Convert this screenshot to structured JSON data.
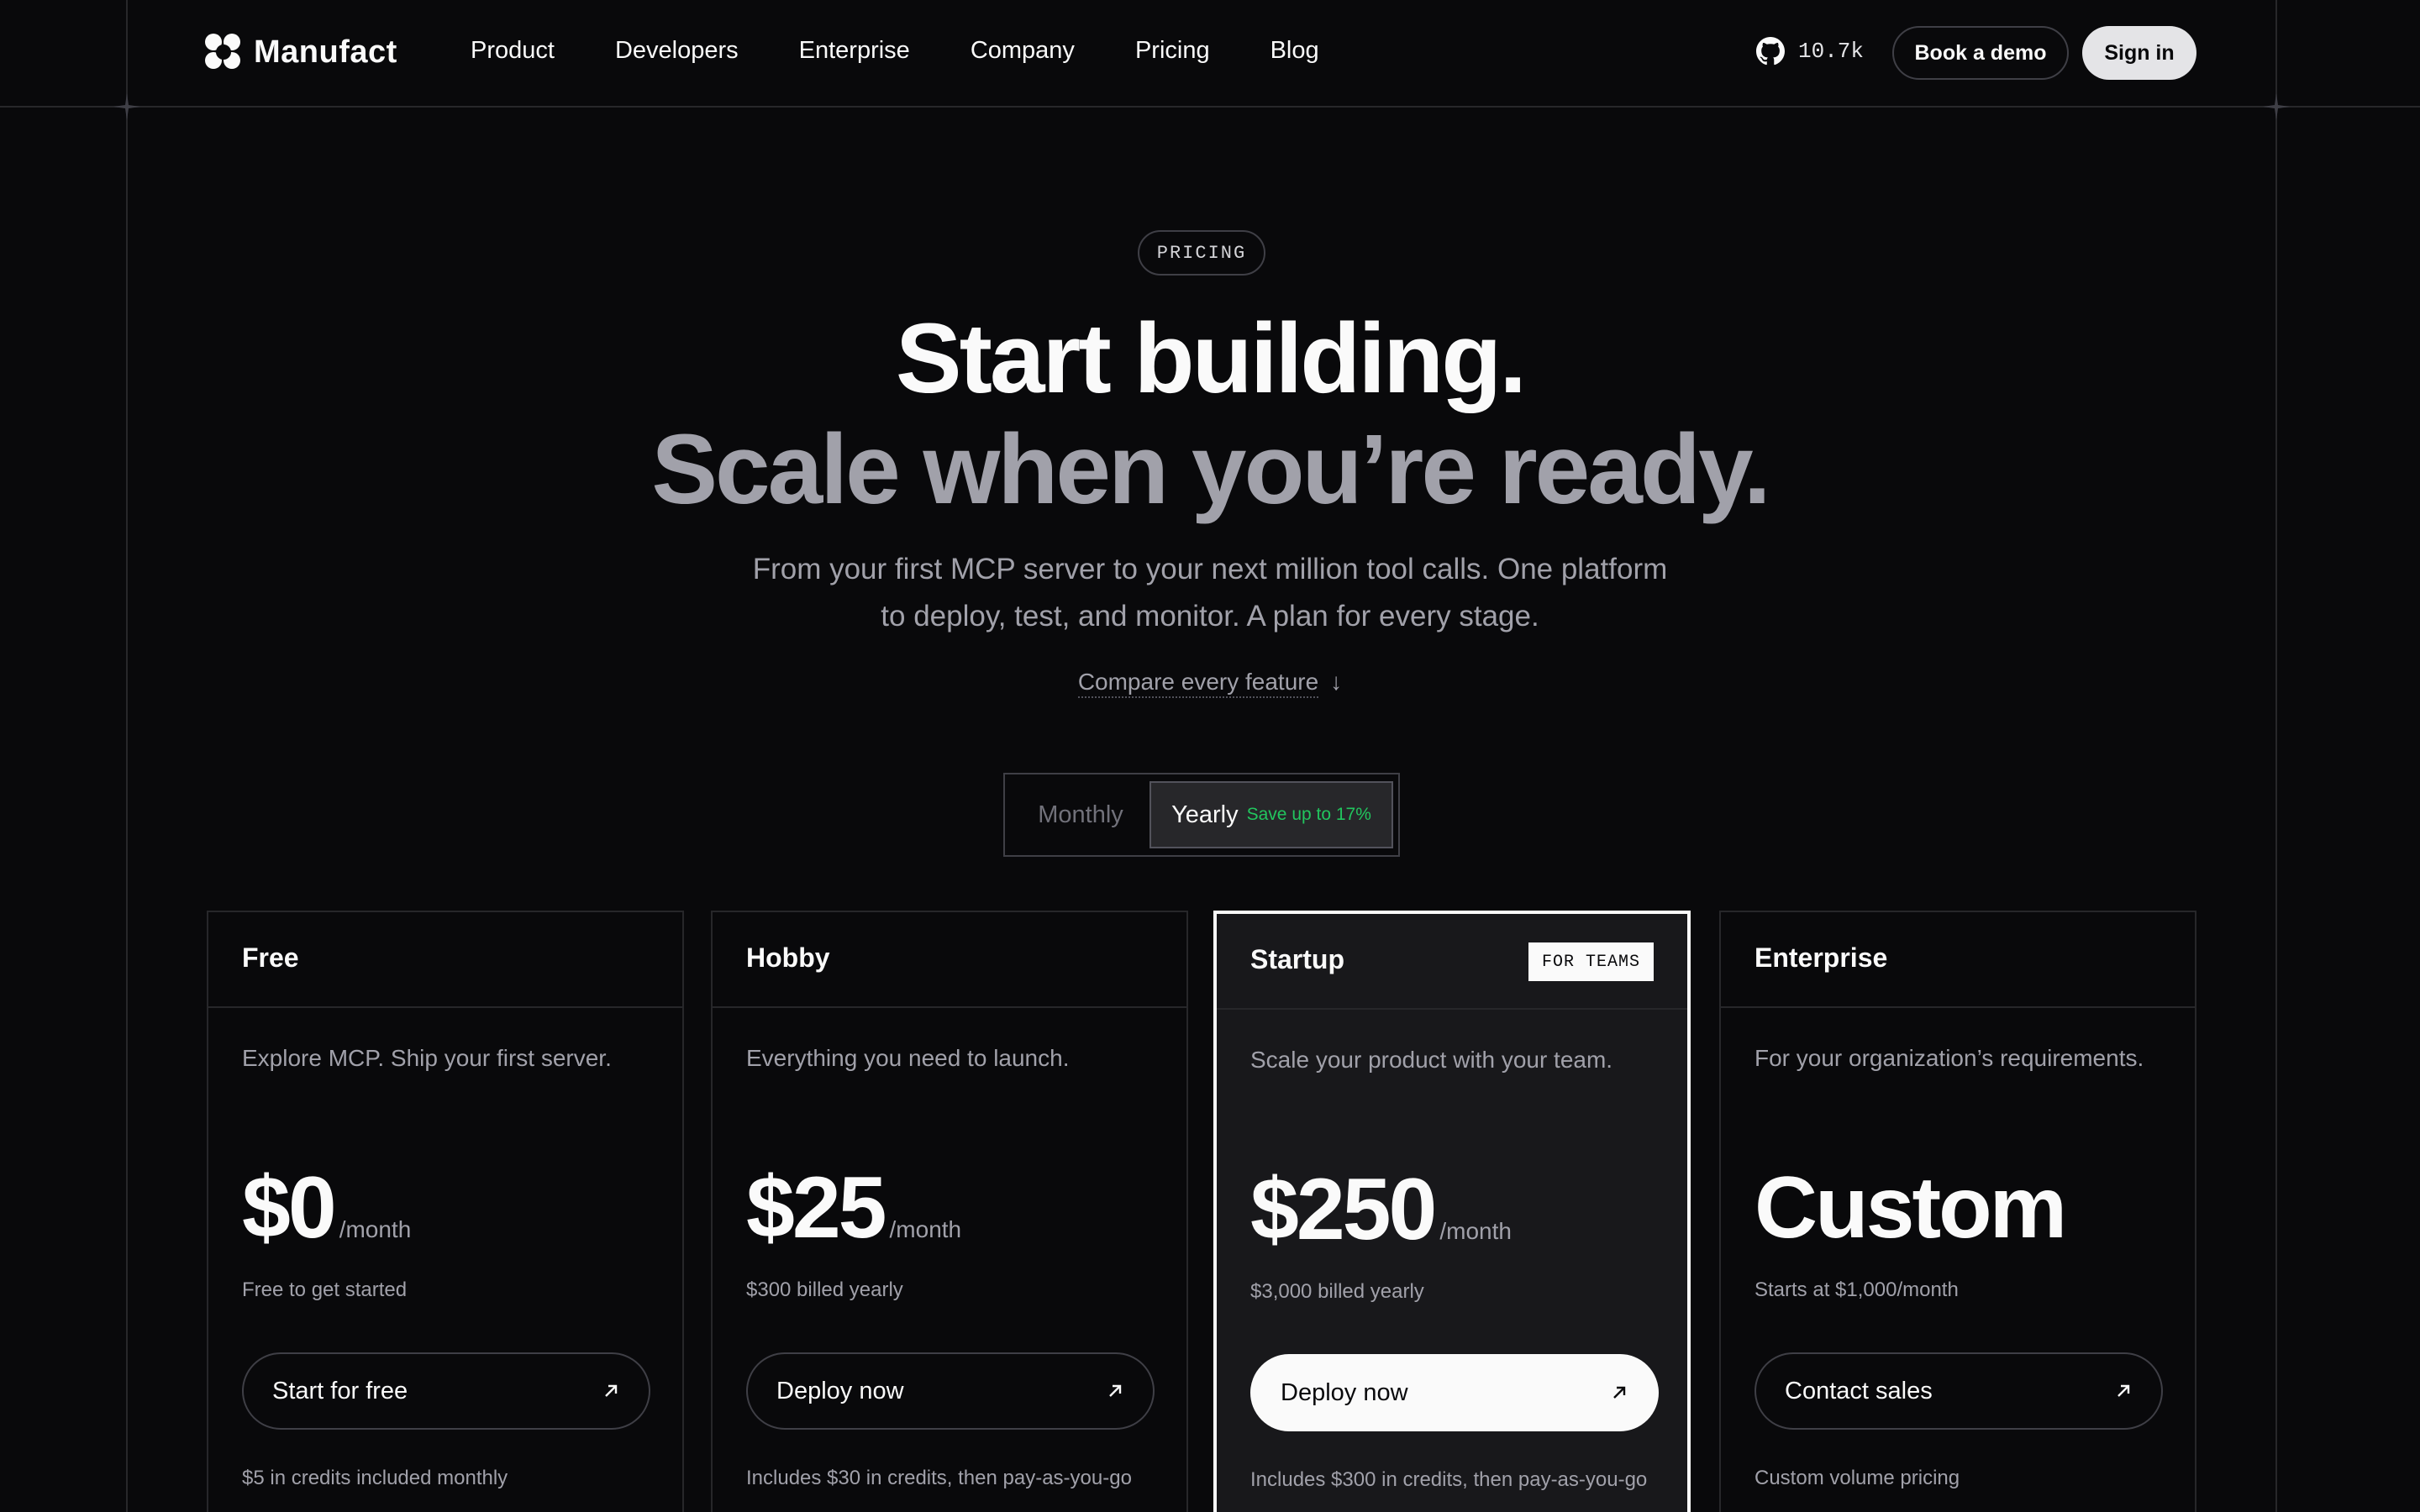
{
  "brand": {
    "name": "Manufact"
  },
  "nav": {
    "links": [
      "Product",
      "Developers",
      "Enterprise",
      "Company",
      "Pricing",
      "Blog"
    ],
    "github_stars": "10.7k",
    "book_demo": "Book a demo",
    "sign_in": "Sign in"
  },
  "hero": {
    "pill": "PRICING",
    "title_line1": "Start building.",
    "title_line2": "Scale when you’re ready.",
    "subtitle": "From your first MCP server to your next million tool calls. One platform to deploy, test, and monitor. A plan for every stage.",
    "compare_link": "Compare every feature"
  },
  "billing_toggle": {
    "monthly": "Monthly",
    "yearly": "Yearly",
    "yearly_badge": "Save up to 17%",
    "selected": "yearly"
  },
  "plans": [
    {
      "name": "Free",
      "badge": "",
      "description": "Explore MCP. Ship your first server.",
      "price": "$0",
      "period": "/month",
      "price_note": "Free to get started",
      "cta": "Start for free",
      "footnote": "$5 in credits included monthly"
    },
    {
      "name": "Hobby",
      "badge": "",
      "description": "Everything you need to launch.",
      "price": "$25",
      "period": "/month",
      "price_note": "$300 billed yearly",
      "cta": "Deploy now",
      "footnote": "Includes $30 in credits, then pay-as-you-go"
    },
    {
      "name": "Startup",
      "badge": "FOR TEAMS",
      "description": "Scale your product with your team.",
      "price": "$250",
      "period": "/month",
      "price_note": "$3,000 billed yearly",
      "cta": "Deploy now",
      "footnote": "Includes $300 in credits, then pay-as-you-go"
    },
    {
      "name": "Enterprise",
      "badge": "",
      "description": "For your organization’s requirements.",
      "price": "Custom",
      "period": "",
      "price_note": "Starts at $1,000/month",
      "cta": "Contact sales",
      "footnote": "Custom volume pricing"
    }
  ],
  "colors": {
    "background": "#09090b",
    "border": "#27272a",
    "muted_text": "#a1a1aa",
    "accent_green": "#22c55e",
    "featured_bg": "#18181b"
  }
}
